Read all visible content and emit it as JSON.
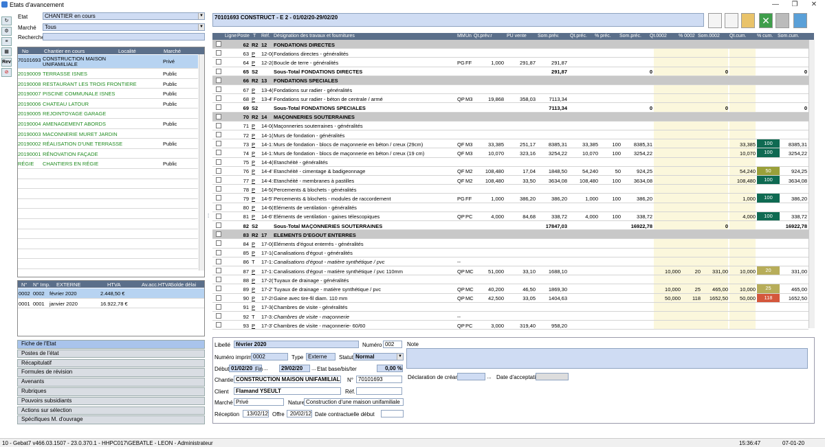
{
  "window": {
    "title": "Etats d'avancement"
  },
  "left": {
    "etat_label": "Etat",
    "etat_value": "CHANTIER en cours",
    "marche_label": "Marché",
    "marche_value": "Tous",
    "recherche_label": "Recherche",
    "recherche_value": "",
    "chantier_headers": [
      "No",
      "Chantier en cours",
      "Localité",
      "Marché"
    ],
    "chantiers": [
      {
        "no": "70101693",
        "name": "CONSTRUCTION MAISON",
        "name2": "UNIFAMILIALE",
        "marche": "Privé"
      },
      {
        "no": "20190009",
        "name": "TERRASSE ISNES",
        "name2": "",
        "marche": "Public"
      },
      {
        "no": "20190008",
        "name": "RESTAURANT LES TROIS FRONTIERE",
        "name2": "",
        "marche": "Public"
      },
      {
        "no": "20190007",
        "name": "PISCINE COMMUNALE ISNES",
        "name2": "",
        "marche": "Public"
      },
      {
        "no": "20190006",
        "name": "CHATEAU LATOUR",
        "name2": "",
        "marche": "Public"
      },
      {
        "no": "20190005",
        "name": "REJOINTOYAGE GARAGE",
        "name2": "",
        "marche": ""
      },
      {
        "no": "20190004",
        "name": "AMENAGEMENT ABORDS",
        "name2": "",
        "marche": "Public"
      },
      {
        "no": "20190003",
        "name": "MACONNERIE MURET JARDIN",
        "name2": "",
        "marche": ""
      },
      {
        "no": "20190002",
        "name": "RÉALISATION D'UNE TERRASSE",
        "name2": "",
        "marche": "Public"
      },
      {
        "no": "20190001",
        "name": "RÉNOVATION FAÇADE",
        "name2": "",
        "marche": ""
      },
      {
        "no": "RÉGIE",
        "name": "CHANTIERS EN RÉGIE",
        "name2": "",
        "marche": "Public"
      }
    ],
    "etat_headers": [
      "N°",
      "N° Imp.",
      "EXTERNE",
      "HTVA",
      "Av.acc.HTVA",
      "Solde délai"
    ],
    "etats": [
      {
        "n": "0002",
        "imp": "0002",
        "ext": "février 2020",
        "htva": "2.448,50 €"
      },
      {
        "n": "0001",
        "imp": "0001",
        "ext": "janvier 2020",
        "htva": "16.922,78 €"
      }
    ],
    "nav": [
      "Fiche de l'Etat",
      "Postes de l'état",
      "Récapitulatif",
      "Formules de révision",
      "Avenants",
      "Rubriques",
      "Pouvoirs subsidiants",
      "Actions sur sélection",
      "Spécifiques M. d'ouvrage"
    ],
    "side_buttons": [
      "Rev"
    ]
  },
  "header_banner": "70101693 CONSTRUCT - E 2 - 01/02/20-29/02/20",
  "table": {
    "headers": [
      "Ligne",
      "Poste",
      "T",
      "Réf.",
      "Désignation des travaux et fournitures",
      "MM",
      "Un",
      "Qt.prév.r",
      "PU vente",
      "Som.prév.",
      "Qt.préc.",
      "% préc.",
      "Som.préc.",
      "Qt.0002",
      "% 0002",
      "Som.0002",
      "Qt.cum.",
      "% cum.",
      "Som.cum."
    ],
    "rows": [
      {
        "k": "hdr",
        "l": "62",
        "t": "R2",
        "r": "12",
        "d": "FONDATIONS DIRECTES"
      },
      {
        "k": "n",
        "l": "63",
        "t": "P",
        "r": "12-0(",
        "d": "Fondations directes - généralités"
      },
      {
        "k": "n",
        "l": "64",
        "t": "P",
        "r": "12-2(",
        "d": "Boucle de terre - généralités",
        "mm": "PG",
        "un": "FF",
        "qp": "1,000",
        "pu": "291,87",
        "sp": "291,87"
      },
      {
        "k": "tot",
        "l": "65",
        "t": "S2",
        "d": "Sous-Total FONDATIONS DIRECTES",
        "sp": "291,87",
        "sc": "0",
        "s2": "0",
        "su": "0"
      },
      {
        "k": "hdr",
        "l": "66",
        "t": "R2",
        "r": "13",
        "d": "FONDATIONS SPECIALES"
      },
      {
        "k": "n",
        "l": "67",
        "t": "P",
        "r": "13-4(",
        "d": "Fondations sur radier - généralités"
      },
      {
        "k": "n",
        "l": "68",
        "t": "P",
        "r": "13-4'",
        "d": "Fondations sur radier - béton de centrale / armé",
        "mm": "QP",
        "un": "M3",
        "qp": "19,868",
        "pu": "358,03",
        "sp": "7113,34"
      },
      {
        "k": "tot",
        "l": "69",
        "t": "S2",
        "d": "Sous-Total FONDATIONS SPECIALES",
        "sp": "7113,34",
        "sc": "0",
        "s2": "0",
        "su": "0"
      },
      {
        "k": "hdr",
        "l": "70",
        "t": "R2",
        "r": "14",
        "d": "MAÇONNERIES SOUTERRAINES"
      },
      {
        "k": "n",
        "l": "71",
        "t": "P",
        "r": "14-0(",
        "d": "Maçonneries souterraines - généralités"
      },
      {
        "k": "n",
        "l": "72",
        "t": "P",
        "r": "14-1(",
        "d": "Murs de fondation - généralités"
      },
      {
        "k": "n",
        "l": "73",
        "t": "P",
        "r": "14-1:",
        "d": "Murs de fondation - blocs de maçonnerie en béton / creux (29cm)",
        "mm": "QF",
        "un": "M3",
        "qp": "33,385",
        "pu": "251,17",
        "sp": "8385,31",
        "qc": "33,385",
        "pc": "100",
        "sc": "8385,31",
        "qu": "33,385",
        "pu2": "100",
        "su": "8385,31",
        "col": "#0f6a52"
      },
      {
        "k": "n",
        "l": "74",
        "t": "P",
        "r": "14-1:",
        "d": "Murs de fondation - blocs de maçonnerie en béton / creux (19 cm)",
        "mm": "QF",
        "un": "M3",
        "qp": "10,070",
        "pu": "323,16",
        "sp": "3254,22",
        "qc": "10,070",
        "pc": "100",
        "sc": "3254,22",
        "qu": "10,070",
        "pu2": "100",
        "su": "3254,22",
        "col": "#0f6a52"
      },
      {
        "k": "n",
        "l": "75",
        "t": "P",
        "r": "14-4(",
        "d": "Etanchéité - généralités"
      },
      {
        "k": "n",
        "l": "76",
        "t": "P",
        "r": "14-4'",
        "d": "Etanchéité - cimentage & badigeonnage",
        "mm": "QF",
        "un": "M2",
        "qp": "108,480",
        "pu": "17,04",
        "sp": "1848,50",
        "qc": "54,240",
        "pc": "50",
        "sc": "924,25",
        "qu": "54,240",
        "pu2": "50",
        "su": "924,25",
        "col": "#9aa03a"
      },
      {
        "k": "n",
        "l": "77",
        "t": "P",
        "r": "14-4:",
        "d": "Etanchéité - membranes à pastilles",
        "mm": "QF",
        "un": "M2",
        "qp": "108,480",
        "pu": "33,50",
        "sp": "3634,08",
        "qc": "108,480",
        "pc": "100",
        "sc": "3634,08",
        "qu": "108,480",
        "pu2": "100",
        "su": "3634,08",
        "col": "#0f6a52"
      },
      {
        "k": "n",
        "l": "78",
        "t": "P",
        "r": "14-5(",
        "d": "Percements & blochets - généralités"
      },
      {
        "k": "n",
        "l": "79",
        "t": "P",
        "r": "14-5'",
        "d": "Percements & blochets - modules de raccordement",
        "mm": "PG",
        "un": "FF",
        "qp": "1,000",
        "pu": "386,20",
        "sp": "386,20",
        "qc": "1,000",
        "pc": "100",
        "sc": "386,20",
        "qu": "1,000",
        "pu2": "100",
        "su": "386,20",
        "col": "#0f6a52"
      },
      {
        "k": "n",
        "l": "80",
        "t": "P",
        "r": "14-6(",
        "d": "Eléments de ventilation - généralités"
      },
      {
        "k": "n",
        "l": "81",
        "t": "P",
        "r": "14-6'",
        "d": "Eléments de ventilation - gaines télescopiques",
        "mm": "QP",
        "un": "PC",
        "qp": "4,000",
        "pu": "84,68",
        "sp": "338,72",
        "qc": "4,000",
        "pc": "100",
        "sc": "338,72",
        "qu": "4,000",
        "pu2": "100",
        "su": "338,72",
        "col": "#0f6a52"
      },
      {
        "k": "tot",
        "l": "82",
        "t": "S2",
        "d": "Sous-Total MAÇONNERIES SOUTERRAINES",
        "sp": "17847,03",
        "sc": "16922,78",
        "s2": "0",
        "su": "16922,78"
      },
      {
        "k": "hdr",
        "l": "83",
        "t": "R2",
        "r": "17",
        "d": "ELEMENTS D'EGOUT ENTERRES"
      },
      {
        "k": "n",
        "l": "84",
        "t": "P",
        "r": "17-0(",
        "d": "Eléments d'égout enterrés - généralités"
      },
      {
        "k": "n",
        "l": "85",
        "t": "P",
        "r": "17-1(",
        "d": "Canalisations d'égout - généralités"
      },
      {
        "k": "it",
        "l": "86",
        "t": "T",
        "r": "17-1:",
        "d": "Canalisations d'égout - matière synthétique / pvc",
        "mm": "--"
      },
      {
        "k": "n",
        "l": "87",
        "t": "P",
        "r": "17-1:",
        "d": "Canalisations d'égout - matière synthétique / pvc 110mm",
        "mm": "QP",
        "un": "MC",
        "qp": "51,000",
        "pu": "33,10",
        "sp": "1688,10",
        "q2": "10,000",
        "p2": "20",
        "s2": "331,00",
        "qu": "10,000",
        "pu2": "20",
        "su": "331,00",
        "col": "#b7ad5a"
      },
      {
        "k": "n",
        "l": "88",
        "t": "P",
        "r": "17-2(",
        "d": "Tuyaux de drainage - généralités"
      },
      {
        "k": "n",
        "l": "89",
        "t": "P",
        "r": "17-2'",
        "d": "Tuyaux de drainage - matière synthétique / pvc",
        "mm": "QP",
        "un": "MC",
        "qp": "40,200",
        "pu": "46,50",
        "sp": "1869,30",
        "q2": "10,000",
        "p2": "25",
        "s2": "465,00",
        "qu": "10,000",
        "pu2": "25",
        "su": "465,00",
        "col": "#b7ad5a"
      },
      {
        "k": "n",
        "l": "90",
        "t": "P",
        "r": "17-2!",
        "d": "Gaine avec tire-fil diam. 110 mm",
        "mm": "QP",
        "un": "MC",
        "qp": "42,500",
        "pu": "33,05",
        "sp": "1404,63",
        "q2": "50,000",
        "p2": "118",
        "s2": "1652,50",
        "qu": "50,000",
        "pu2": "118",
        "su": "1652,50",
        "col": "#d4573c"
      },
      {
        "k": "n",
        "l": "91",
        "t": "P",
        "r": "17-3(",
        "d": "Chambres de visite - généralités"
      },
      {
        "k": "it",
        "l": "92",
        "t": "T",
        "r": "17-3:",
        "d": "Chambres de visite - maçonnerie",
        "mm": "--"
      },
      {
        "k": "n",
        "l": "93",
        "t": "P",
        "r": "17-3'",
        "d": "Chambres de visite - maçonnerie- 60/60",
        "mm": "QP",
        "un": "PC",
        "qp": "3,000",
        "pu": "319,40",
        "sp": "958,20"
      }
    ]
  },
  "form": {
    "libelle_label": "Libellé",
    "libelle": "février 2020",
    "numero_label": "Numéro",
    "numero": "002",
    "note_label": "Note",
    "numimp_label": "Numéro imprimé",
    "numimp": "0002",
    "type_label": "Type",
    "type": "Externe",
    "statut_label": "Statut",
    "statut": "Normal",
    "debut_label": "Début",
    "debut": "01/02/20",
    "fin_label": "Fin",
    "fin": "29/02/20",
    "etatbase_label": "Etat base/bis/ter",
    "pct": "0,00 %",
    "decl_label": "Déclaration de créance",
    "date_acc_label": "Date d'acceptation",
    "chantier_label": "Chantier",
    "chantier": "CONSTRUCTION MAISON UNIFAMILIALE",
    "no_label": "N°",
    "no": "70101693",
    "client_label": "Client",
    "client": "Flamand YSEULT",
    "ref_label": "Réf.",
    "ref": "",
    "marche_label": "Marché",
    "marche": "Privé",
    "nature_label": "Nature",
    "nature": "Construction d'une maison unifamiliale",
    "reception_label": "Réception",
    "reception": "13/02/12",
    "offre_label": "Offre",
    "offre": "20/02/12",
    "datecontr_label": "Date contractuelle début",
    "datecontr": ""
  },
  "statusbar": {
    "left": "10 - Gebat7 v466.03.1507 - 23.0.370.1 - HHPC017\\GEBATLE - LEON - Administrateur",
    "time": "15:36:47",
    "date": "07-01-20"
  }
}
